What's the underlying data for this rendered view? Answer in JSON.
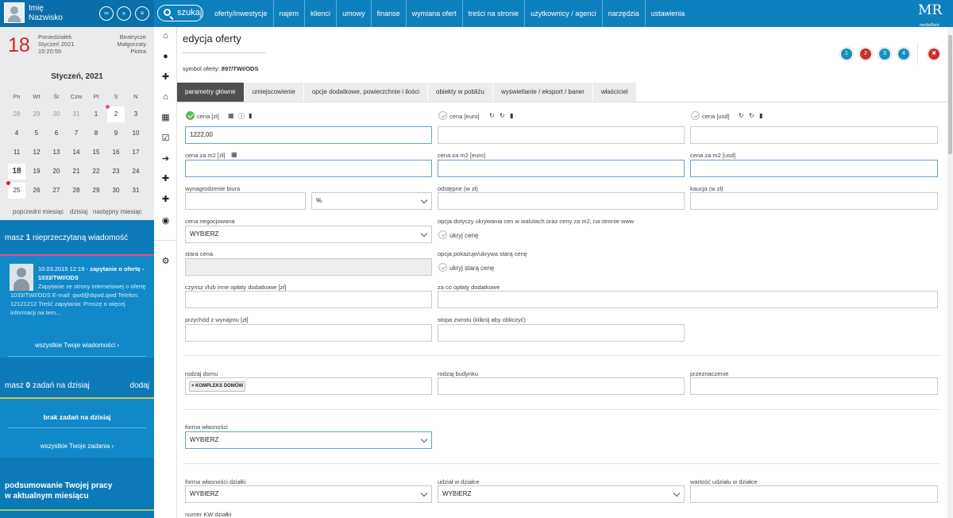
{
  "user": {
    "first_name": "Imię",
    "last_name": "Nazwisko"
  },
  "search": {
    "label": "szukaj"
  },
  "menu": [
    "oferty/inwestycje",
    "najem",
    "klienci",
    "umowy",
    "finanse",
    "wymiana ofert",
    "treści na stronie",
    "użytkownicy / agenci",
    "narzędzia",
    "ustawienia"
  ],
  "logo": {
    "mark": "MR",
    "sub": "mediaRent"
  },
  "calendar": {
    "day_number": "18",
    "weekday": "Poniedziałek",
    "date": "Styczeń 2021",
    "time": "15:20:55",
    "name_days": [
      "Beatrycze",
      "Małgorzaty",
      "Piotra"
    ],
    "month_title": "Styczeń, 2021",
    "weekdays": [
      "Pn",
      "Wt",
      "Śr",
      "Czw",
      "Pt",
      "S",
      "N"
    ],
    "weeks": [
      [
        "28",
        "29",
        "30",
        "31",
        "1",
        "2",
        "3"
      ],
      [
        "4",
        "5",
        "6",
        "7",
        "8",
        "9",
        "10"
      ],
      [
        "11",
        "12",
        "13",
        "14",
        "15",
        "16",
        "17"
      ],
      [
        "18",
        "19",
        "20",
        "21",
        "22",
        "23",
        "24"
      ],
      [
        "25",
        "26",
        "27",
        "28",
        "29",
        "30",
        "31"
      ]
    ],
    "prev_label": "poprzedni miesiąc",
    "today_label": "dzisiaj",
    "next_label": "następny miesiąc"
  },
  "messages": {
    "header_pre": "masz ",
    "count": "1",
    "header_post": " nieprzeczytaną wiadomość",
    "item_datetime": "10.03.2015 12:19",
    "item_title": "zapytanie o ofertę - 1033/TWI/ODS",
    "item_body": "Zapytanie ze strony internetowej o ofertę 1033/TWI/ODS E-mail: qwd@dqwd.qwd Telefon: 12121212 Treść zapytania: Proszę o więcej informacji na tem...",
    "all_label": "wszystkie Twoje wiadomości"
  },
  "tasks": {
    "header_pre": "masz ",
    "count": "0",
    "header_post": " zadań na dzisiaj",
    "add_label": "dodaj",
    "empty_label": "brak zadań na dzisiaj",
    "all_label": "wszystkie Twoje zadania"
  },
  "summary": {
    "line1": "podsumowanie Twojej pracy",
    "line2": "w aktualnym miesiącu"
  },
  "page": {
    "title": "edycja oferty",
    "symbol_label": "symbol oferty:",
    "symbol_value": "897/TWI/ODS"
  },
  "steps": [
    "1",
    "2",
    "3",
    "4"
  ],
  "tabs": [
    "parametry główne",
    "umiejscowienie",
    "opcje dodatkowe, powierzchnie i ilości",
    "obiekty w pobliżu",
    "wyświetlanie / eksport / baner",
    "właściciel"
  ],
  "form": {
    "price_pln_label": "cena [zł]",
    "price_pln_value": "1222,00",
    "price_eur_label": "cena [euro]",
    "price_usd_label": "cena [usd]",
    "m2_pln_label": "cena za m2 [zł]",
    "m2_eur_label": "cena za m2 [euro]",
    "m2_usd_label": "cena za m2 [usd]",
    "fee_label": "wynagrodzenie biura",
    "fee_unit": "%",
    "odstepne_label": "odstępne (w zł)",
    "kaucja_label": "kaucja (w zł)",
    "negotiated_label": "cena negocjowana",
    "select_placeholder": "WYBIERZ",
    "hide_prices_option": "opcja dotyczy ukrywania cen w walutach oraz ceny za m2, na stronie www",
    "hide_price_label": "ukryj cenę",
    "old_price_label": "stara cena",
    "old_price_option": "opcja pokazuje/ukrywa starą cenę",
    "hide_old_price_label": "ukryj starą cenę",
    "rent_fees_label": "czynsz i/lub inne opłaty dodatkowe [zł]",
    "fees_for_label": "za co opłaty dodatkowe",
    "rental_income_label": "przychód z wynajmu [zł]",
    "return_rate_label": "stopa zwrotu (kliknij aby obliczyć)",
    "house_type_label": "rodzaj domu",
    "house_type_tag": "KOMPLEKS DOMÓW",
    "building_type_label": "rodzaj budynku",
    "purpose_label": "przeznaczenie",
    "ownership_label": "forma własności",
    "plot_ownership_label": "forma własności działki",
    "plot_share_label": "udział w działce",
    "share_value_label": "wartość udziału w działce",
    "kw_label": "numer KW działki"
  },
  "colors": {
    "topbar": "#0e7fbd",
    "sidebar_blue": "#1189c8",
    "active_tab": "#4f4f4f",
    "step1": "#1a8ebf",
    "step2": "#c9302c",
    "close": "#c9302c",
    "check_on": "#5cb85c"
  }
}
